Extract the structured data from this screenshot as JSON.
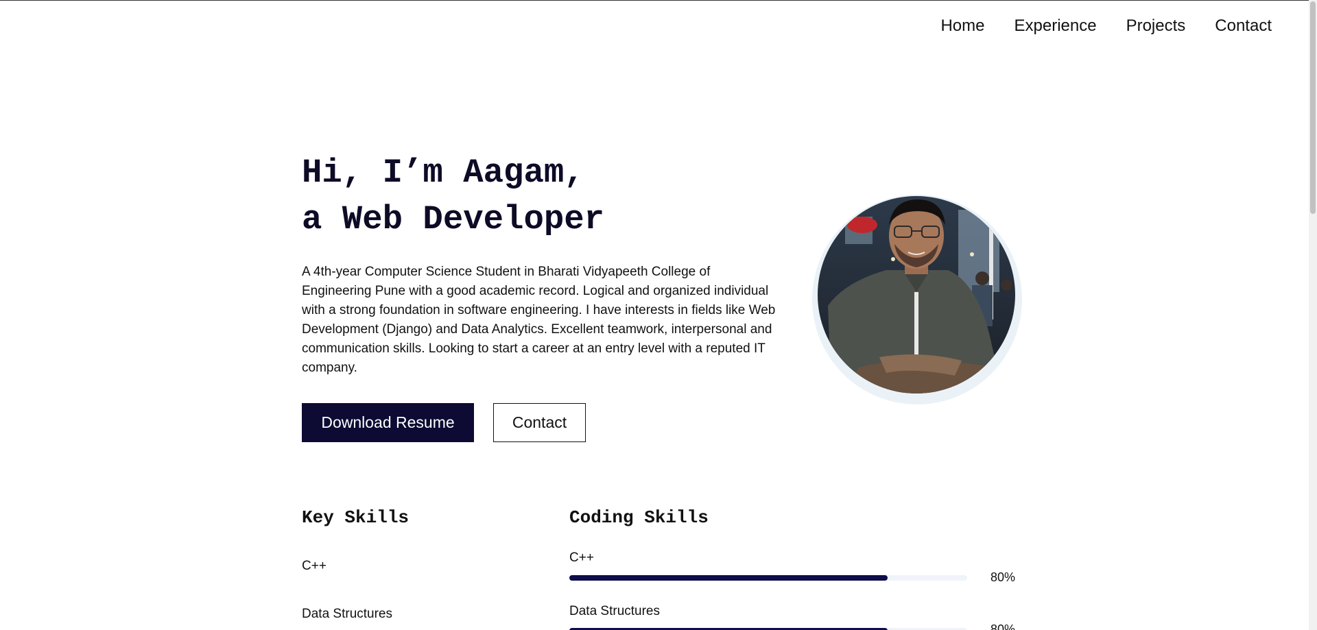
{
  "nav": {
    "items": [
      {
        "label": "Home"
      },
      {
        "label": "Experience"
      },
      {
        "label": "Projects"
      },
      {
        "label": "Contact"
      }
    ]
  },
  "hero": {
    "title_line1": "Hi, I’m Aagam,",
    "title_line2": "a Web Developer",
    "description": "A 4th-year Computer Science Student in Bharati Vidyapeeth College of Engineering Pune with a good academic record. Logical and organized individual with a strong foundation in software engineering. I have interests in fields like Web Development (Django) and Data Analytics. Excellent teamwork, interpersonal and communication skills. Looking to start a career at an entry level with a reputed IT company.",
    "download_button": "Download Resume",
    "contact_button": "Contact"
  },
  "key_skills": {
    "title": "Key Skills",
    "items": [
      "C++",
      "Data Structures"
    ]
  },
  "coding_skills": {
    "title": "Coding Skills",
    "items": [
      {
        "label": "C++",
        "percent_text": "80%",
        "value": 0.8
      },
      {
        "label": "Data Structures",
        "percent_text": "80%",
        "value": 0.8
      }
    ]
  },
  "colors": {
    "primary": "#0d0b33",
    "bar_fill": "#0f0d4a",
    "bar_track": "#f0f4fa"
  }
}
